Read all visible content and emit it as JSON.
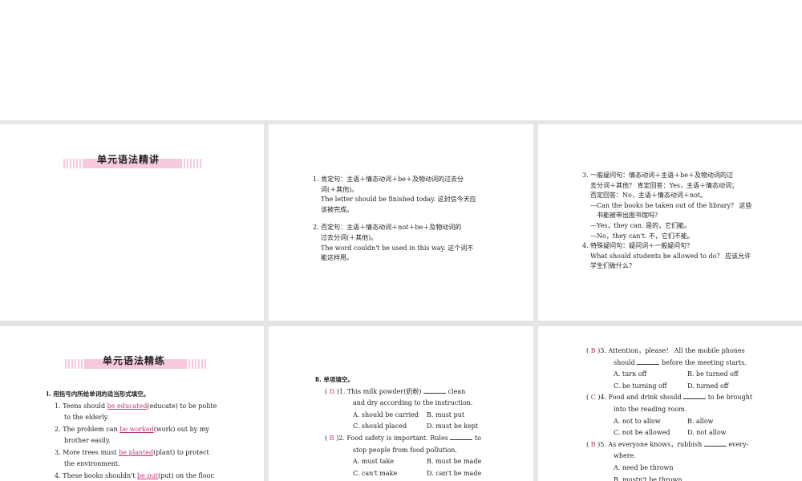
{
  "slide1": {
    "title": "单元语法精讲"
  },
  "slide2": {
    "lines": [
      "1. 肯定句：主语＋情态动词＋be＋及物动词的过去分",
      "词(＋其他)。",
      "The letter should be finished today. 这封信今天应",
      "该被完成。",
      "2. 否定句：主语＋情态动词＋not＋be＋及物动词的",
      "过去分词(＋其他)。",
      "The word couldn't be used in this way. 这个词不",
      "能这样用。"
    ]
  },
  "slide3": {
    "lines": [
      "3. 一般疑问句：情态动词＋主语＋be＋及物动词的过",
      "去分词＋其他？ 肯定回答：Yes，主语＋情态动词；",
      "否定回答：No，主语＋情态动词＋not。",
      "—Can the books be taken out of the library？ 这些",
      "书能被带出图书馆吗？",
      "—Yes，they can. 是的，它们能。",
      "—No，they can't. 不，它们不能。",
      "4. 特殊疑问句：疑问词＋一般疑问句？",
      "What should students be allowed to do？ 应该允许",
      "学生们做什么？"
    ]
  },
  "slide4": {
    "title": "单元语法精练",
    "heading": "Ⅰ. 用括号内所给单词的适当形式填空。",
    "items": [
      {
        "pre": "1. Teens should ",
        "ans": "be educated",
        "post": "(educate) to be polite",
        "cont": "to the elderly."
      },
      {
        "pre": "2. The problem can ",
        "ans": "be worked",
        "post": "(work) out by my",
        "cont": "brother easily."
      },
      {
        "pre": "3. More trees must ",
        "ans": "be planted",
        "post": "(plant) to protect",
        "cont": "the environment."
      },
      {
        "pre": "4. These books shouldn't ",
        "ans": "be put",
        "post": "(put) on the floor.",
        "cont": ""
      }
    ]
  },
  "slide5": {
    "heading": "Ⅱ. 单项填空。",
    "questions": [
      {
        "ans": "D",
        "num": ")1.",
        "stem": [
          "This milk powder(奶粉) ",
          " clean",
          "and dry according to the instruction."
        ],
        "opts": [
          "A. should be carried",
          "B. must put",
          "C. should placed",
          "D. must be kept"
        ]
      },
      {
        "ans": "B",
        "num": ")2.",
        "stem": [
          "Food safety is important. Rules ",
          " to",
          "stop people from food pollution."
        ],
        "opts": [
          "A. must take",
          "B. must be made",
          "C. can't make",
          "D. can't be made"
        ]
      }
    ]
  },
  "slide6": {
    "questions": [
      {
        "ans": "B",
        "num": ")3.",
        "stem": [
          "Attention，please！ All the mobile phones",
          "should ",
          " before the meeting starts."
        ],
        "opts": [
          "A. turn off",
          "B. be turned off",
          "C. be turning off",
          "D. turned off"
        ]
      },
      {
        "ans": "C",
        "num": ")4.",
        "stem": [
          "Food and drink should ",
          " to be brought",
          "into the reading room."
        ],
        "opts": [
          "A. not to allow",
          "B. allow",
          "C. not be allowed",
          "D. not allow"
        ]
      },
      {
        "ans": "B",
        "num": ")5.",
        "stem": [
          "As everyone knows，rubbish ",
          " every-",
          "where."
        ],
        "opts": [
          "A. need be thrown",
          "B. mustn't be thrown"
        ]
      }
    ]
  }
}
